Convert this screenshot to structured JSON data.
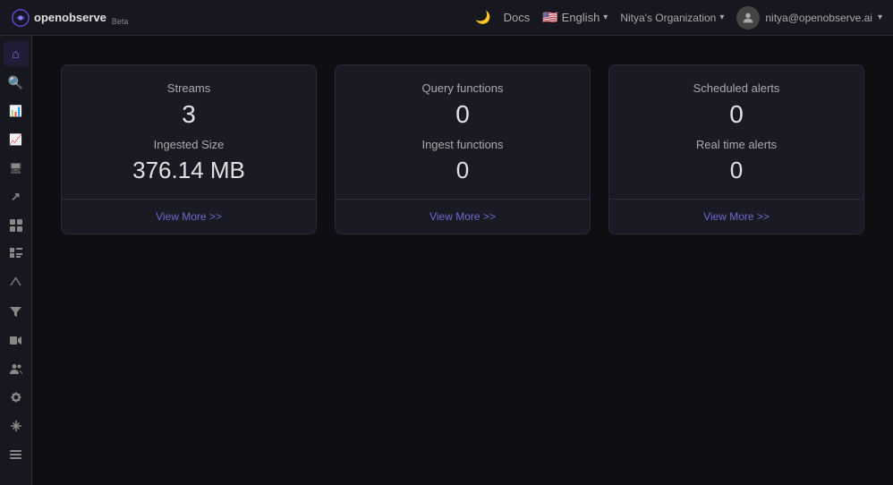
{
  "navbar": {
    "logo_text": "openobserve",
    "beta_label": "Beta",
    "docs_label": "Docs",
    "language_label": "English",
    "org_label": "Nitya's Organization",
    "user_email": "nitya@openobserve.ai"
  },
  "sidebar": {
    "items": [
      {
        "id": "home",
        "icon": "⌂",
        "label": "Home",
        "active": true
      },
      {
        "id": "search",
        "icon": "🔍",
        "label": "Search",
        "active": false
      },
      {
        "id": "logs",
        "icon": "📊",
        "label": "Logs",
        "active": false
      },
      {
        "id": "metrics",
        "icon": "📈",
        "label": "Metrics",
        "active": false
      },
      {
        "id": "traces",
        "icon": "🖥",
        "label": "Traces",
        "active": false
      },
      {
        "id": "rum",
        "icon": "↗",
        "label": "RUM",
        "active": false
      },
      {
        "id": "dashboards",
        "icon": "⊞",
        "label": "Dashboards",
        "active": false
      },
      {
        "id": "reports",
        "icon": "▦",
        "label": "Reports",
        "active": false
      },
      {
        "id": "alerts",
        "icon": "🔔",
        "label": "Alerts",
        "active": false
      },
      {
        "id": "filters",
        "icon": "⚡",
        "label": "Filters",
        "active": false
      },
      {
        "id": "video",
        "icon": "▶",
        "label": "Video",
        "active": false
      },
      {
        "id": "users",
        "icon": "👥",
        "label": "Users",
        "active": false
      },
      {
        "id": "settings",
        "icon": "⚙",
        "label": "Settings",
        "active": false
      },
      {
        "id": "integrations",
        "icon": "✚",
        "label": "Integrations",
        "active": false
      },
      {
        "id": "more",
        "icon": "≡",
        "label": "More",
        "active": false
      }
    ]
  },
  "cards": [
    {
      "id": "streams",
      "title": "Streams",
      "value": "3",
      "subtitle": "Ingested Size",
      "subvalue": "376.14 MB",
      "view_more": "View More >>"
    },
    {
      "id": "functions",
      "title": "Query functions",
      "value": "0",
      "subtitle": "Ingest functions",
      "subvalue": "0",
      "view_more": "View More >>"
    },
    {
      "id": "alerts",
      "title": "Scheduled alerts",
      "value": "0",
      "subtitle": "Real time alerts",
      "subvalue": "0",
      "view_more": "View More >>"
    }
  ]
}
